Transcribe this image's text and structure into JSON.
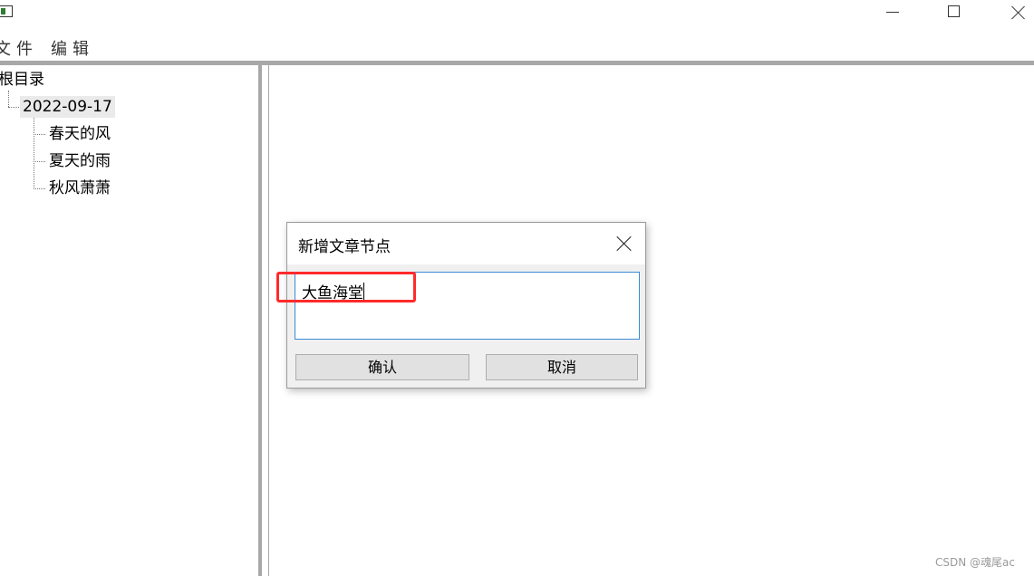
{
  "window": {
    "minimize_icon": "minimize-icon",
    "maximize_icon": "maximize-icon",
    "close_icon": "close-icon"
  },
  "menu": {
    "file": "文件",
    "edit": "编辑"
  },
  "tree": {
    "root": "根目录",
    "date_node": "2022-09-17",
    "children": [
      "春天的风",
      "夏天的雨",
      "秋风萧萧"
    ]
  },
  "dialog": {
    "title": "新增文章节点",
    "input_value": "大鱼海堂",
    "confirm_label": "确认",
    "cancel_label": "取消"
  },
  "annotation": {
    "highlight_color": "#ff2a2a"
  },
  "watermark": "CSDN @魂尾ac"
}
